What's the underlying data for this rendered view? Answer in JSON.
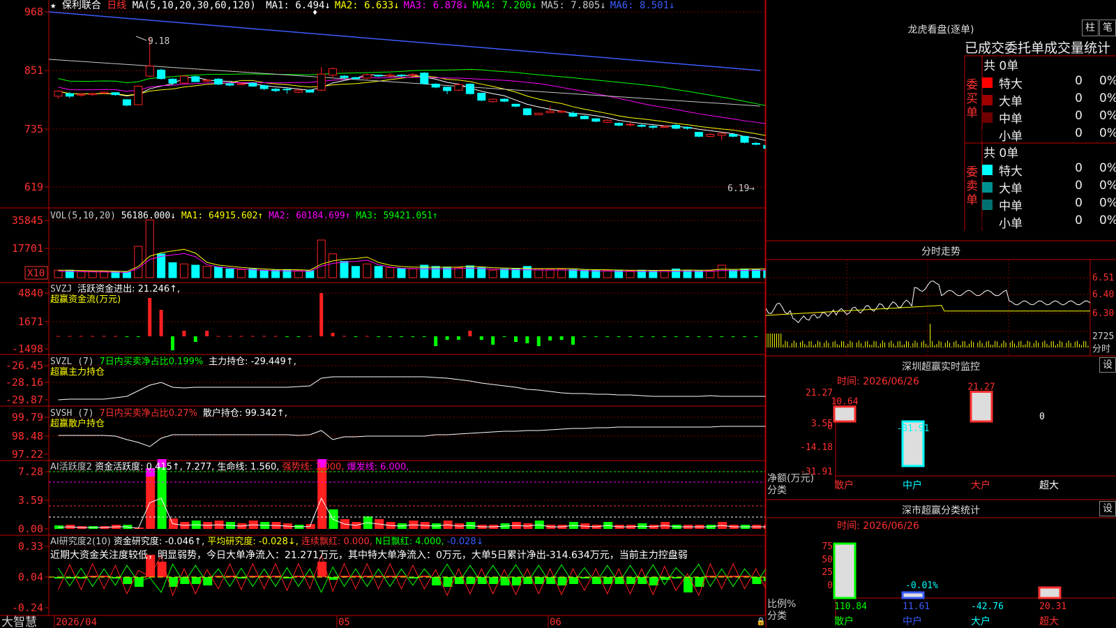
{
  "main": {
    "stock": "保利联合",
    "period": "日线",
    "ma_label": "MA(5,10,20,30,60,120)",
    "ma_items": [
      {
        "text": "MA1: 6.494↓",
        "color": "#ffffff"
      },
      {
        "text": "MA2: 6.633↓",
        "color": "#ffff00"
      },
      {
        "text": "MA3: 6.878↓",
        "color": "#ff00ff"
      },
      {
        "text": "MA4: 7.200↓",
        "color": "#00ff00"
      },
      {
        "text": "MA5: 7.805↓",
        "color": "#c8c8c8"
      },
      {
        "text": "MA6: 8.501↓",
        "color": "#3c5cff"
      }
    ],
    "y_ticks": [
      "968",
      "851",
      "735",
      "619"
    ],
    "high_label": "9.18",
    "low_label": "6.19"
  },
  "vol": {
    "title": "VOL(5,10,20)",
    "value": "56186.000↓",
    "ma1": "MA1: 64915.602↑",
    "ma2": "MA2: 60184.699↑",
    "ma3": "MA3: 59421.051↑",
    "y_ticks": [
      "35845",
      "17701"
    ],
    "unit": "X10"
  },
  "svzj": {
    "title": "SVZJ",
    "line1": "活跃资金进出: 21.246↑,",
    "line2": "超赢资金流(万元)",
    "y_ticks": [
      "4840",
      "1671",
      "-1498"
    ]
  },
  "svzl": {
    "title": "SVZL (7)",
    "text1": "7日内买卖净占比0.199%",
    "text2": "主力持仓: -29.449↑,",
    "line2": "超赢主力持仓",
    "y_ticks": [
      "-26.45",
      "-28.16",
      "-29.87"
    ]
  },
  "svsh": {
    "title": "SVSH (7)",
    "text1": "7日内买卖净占比0.27%",
    "text2": "散户持仓: 99.342↑,",
    "line2": "超赢散户持仓",
    "y_ticks": [
      "99.79",
      "98.48",
      "97.22"
    ]
  },
  "ai1": {
    "title": "AI活跃度2",
    "t1": "资金活跃度: 0.415↑,",
    "t2": "7.277,",
    "t3": "生命线: 1.560,",
    "t4": "强势线: 3.000,",
    "t5": "爆发线: 6.000,",
    "y_ticks": [
      "7.28",
      "3.59",
      "0.00"
    ]
  },
  "ai2": {
    "title": "AI研究度2(10)",
    "t1": "资金研究度: -0.046↑,",
    "t2": "平均研究度: -0.028↓,",
    "t3": "连续飘红: 0.000,",
    "t4": "N日飘红: 4.000,",
    "t5": "-0.028↓",
    "comment": "近期大资金关注度较低，明显弱势，今日大单净流入：21.271万元，其中特大单净流入：0万元，大单5日累计净出-314.634万元，当前主力控盘弱",
    "y_ticks": [
      "0.33",
      "0.04",
      "-0.24"
    ]
  },
  "bottom": {
    "brand": "大智慧",
    "date_labels": [
      "2026/04",
      "05",
      "06"
    ]
  },
  "right": {
    "header": "龙虎看盘(逐单)",
    "btn_bar": "柱",
    "btn_stroke": "笔",
    "stats_title": "已成交委托单成交量统计",
    "buy_label": "委买单",
    "sell_label": "委卖单",
    "buy_total": "共 0单",
    "sell_total": "共 0单",
    "buy_rows": [
      {
        "label": "特大",
        "v1": "0",
        "v2": "0%",
        "color": "#ff0000"
      },
      {
        "label": "大单",
        "v1": "0",
        "v2": "0%",
        "color": "#a00000"
      },
      {
        "label": "中单",
        "v1": "0",
        "v2": "0%",
        "color": "#700000"
      },
      {
        "label": "小单",
        "v1": "0",
        "v2": "0%",
        "color": "#000000"
      }
    ],
    "sell_rows": [
      {
        "label": "特大",
        "v1": "0",
        "v2": "0%",
        "color": "#00ffff"
      },
      {
        "label": "大单",
        "v1": "0",
        "v2": "0%",
        "color": "#009090"
      },
      {
        "label": "中单",
        "v1": "0",
        "v2": "0%",
        "color": "#007070"
      },
      {
        "label": "小单",
        "v1": "0",
        "v2": "0%",
        "color": "#000000"
      }
    ],
    "intraday_title": "分时走势",
    "intraday_ticks": [
      "6.51",
      "6.40",
      "6.30",
      "2725",
      "分时"
    ],
    "monitor_title": "深圳超赢实时监控",
    "monitor_btn": "设",
    "monitor_time": "时间: 2026/06/26",
    "monitor_yticks": [
      "21.27",
      "3.55",
      "0",
      "-14.18",
      "-31.91"
    ],
    "monitor_bars": [
      {
        "cat": "散户",
        "value": "10.64",
        "color": "#ff3030"
      },
      {
        "cat": "中户",
        "value": "-31.91",
        "color": "#00ffff"
      },
      {
        "cat": "大户",
        "value": "21.27",
        "color": "#ff3030"
      },
      {
        "cat": "超大",
        "value": "0",
        "color": "#ffffff"
      }
    ],
    "monitor_ylabel": "净额(万元)",
    "monitor_xlabel": "分类",
    "class_title": "深市超赢分类统计",
    "class_btn": "设",
    "class_time": "时间: 2026/06/26",
    "class_yticks": [
      "75",
      "50",
      "25",
      "0"
    ],
    "class_ylabel": "比例%",
    "class_xlabel": "分类",
    "class_bars": [
      {
        "cat": "散户",
        "value": "110.84",
        "color": "#00ff00"
      },
      {
        "cat": "中户",
        "value": "11.61",
        "color": "#3c5cff"
      },
      {
        "cat": "大户",
        "value": "-42.76",
        "color": "#00ffff"
      },
      {
        "cat": "超大",
        "value": "20.31",
        "color": "#ff3030"
      }
    ],
    "class_mid_label": "-0.01%"
  },
  "colors": {
    "up": "#ff2020",
    "down": "#00ffff",
    "border": "#c00000",
    "grid": "#800000"
  },
  "chart_data": {
    "type": "candlestick",
    "candles": [
      [
        8.0,
        8.1,
        7.95,
        8.12
      ],
      [
        8.05,
        8.0,
        7.96,
        8.08
      ],
      [
        8.02,
        8.04,
        7.99,
        8.06
      ],
      [
        8.03,
        8.05,
        8.01,
        8.07
      ],
      [
        8.06,
        8.08,
        8.04,
        8.09
      ],
      [
        8.07,
        8.03,
        8.01,
        8.08
      ],
      [
        7.93,
        7.82,
        7.8,
        7.94
      ],
      [
        7.83,
        8.2,
        7.82,
        8.22
      ],
      [
        8.4,
        8.6,
        8.38,
        9.18
      ],
      [
        8.52,
        8.35,
        8.33,
        8.55
      ],
      [
        8.34,
        8.26,
        8.22,
        8.36
      ],
      [
        8.26,
        8.4,
        8.25,
        8.42
      ],
      [
        8.39,
        8.29,
        8.28,
        8.41
      ],
      [
        8.3,
        8.32,
        8.28,
        8.34
      ],
      [
        8.34,
        8.24,
        8.22,
        8.36
      ],
      [
        8.25,
        8.22,
        8.2,
        8.27
      ],
      [
        8.23,
        8.25,
        8.22,
        8.26
      ],
      [
        8.26,
        8.2,
        8.19,
        8.28
      ],
      [
        8.21,
        8.15,
        8.12,
        8.23
      ],
      [
        8.14,
        8.11,
        8.08,
        8.16
      ],
      [
        8.14,
        8.13,
        8.05,
        8.16
      ],
      [
        8.08,
        8.12,
        8.06,
        8.14
      ],
      [
        8.12,
        8.08,
        8.07,
        8.14
      ],
      [
        8.12,
        8.44,
        8.1,
        8.58
      ],
      [
        8.42,
        8.55,
        8.36,
        8.57
      ],
      [
        8.4,
        8.37,
        8.33,
        8.42
      ],
      [
        8.37,
        8.35,
        8.33,
        8.39
      ],
      [
        8.36,
        8.43,
        8.34,
        8.45
      ],
      [
        8.42,
        8.4,
        8.38,
        8.43
      ],
      [
        8.4,
        8.42,
        8.39,
        8.46
      ],
      [
        8.42,
        8.41,
        8.38,
        8.44
      ],
      [
        8.42,
        8.43,
        8.4,
        8.46
      ],
      [
        8.46,
        8.25,
        8.23,
        8.48
      ],
      [
        8.24,
        8.18,
        8.16,
        8.26
      ],
      [
        8.18,
        8.11,
        8.04,
        8.19
      ],
      [
        8.12,
        8.23,
        8.1,
        8.26
      ],
      [
        8.24,
        8.05,
        8.03,
        8.26
      ],
      [
        8.06,
        7.92,
        7.9,
        8.07
      ],
      [
        7.89,
        7.94,
        7.87,
        7.95
      ],
      [
        7.94,
        7.9,
        7.88,
        7.96
      ],
      [
        7.84,
        7.8,
        7.78,
        7.85
      ],
      [
        7.75,
        7.63,
        7.61,
        7.76
      ],
      [
        7.63,
        7.66,
        7.62,
        7.67
      ],
      [
        7.67,
        7.7,
        7.66,
        7.8
      ],
      [
        7.68,
        7.7,
        7.66,
        7.72
      ],
      [
        7.66,
        7.6,
        7.58,
        7.7
      ],
      [
        7.6,
        7.55,
        7.54,
        7.62
      ],
      [
        7.55,
        7.5,
        7.48,
        7.56
      ],
      [
        7.48,
        7.52,
        7.46,
        7.54
      ],
      [
        7.46,
        7.42,
        7.4,
        7.48
      ],
      [
        7.43,
        7.44,
        7.4,
        7.5
      ],
      [
        7.42,
        7.4,
        7.38,
        7.45
      ],
      [
        7.4,
        7.38,
        7.35,
        7.42
      ],
      [
        7.38,
        7.4,
        7.37,
        7.42
      ],
      [
        7.42,
        7.36,
        7.34,
        7.45
      ],
      [
        7.38,
        7.36,
        7.33,
        7.4
      ],
      [
        7.28,
        7.2,
        7.18,
        7.29
      ],
      [
        7.2,
        7.24,
        7.18,
        7.26
      ],
      [
        7.22,
        7.26,
        7.12,
        7.28
      ],
      [
        7.24,
        7.2,
        7.18,
        7.26
      ],
      [
        7.2,
        7.08,
        7.06,
        7.21
      ],
      [
        7.06,
        7.04,
        7.02,
        7.09
      ],
      [
        7.02,
        6.96,
        6.94,
        7.03
      ]
    ]
  }
}
